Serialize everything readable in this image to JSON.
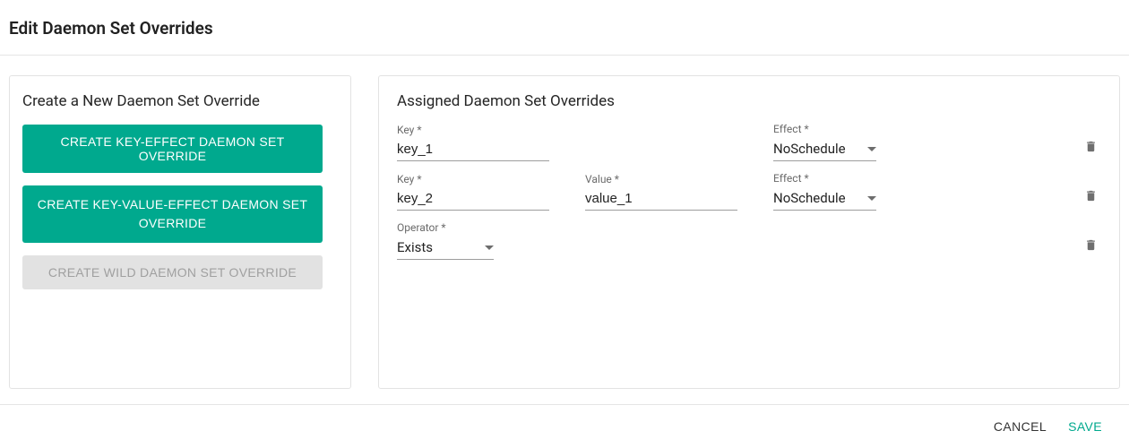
{
  "page": {
    "title": "Edit Daemon Set Overrides"
  },
  "createPanel": {
    "title": "Create a New Daemon Set Override",
    "buttons": {
      "keyEffect": "CREATE KEY-EFFECT DAEMON SET OVERRIDE",
      "keyValueEffect": "CREATE KEY-VALUE-EFFECT DAEMON SET OVERRIDE",
      "wild": "CREATE WILD DAEMON SET OVERRIDE"
    }
  },
  "assignedPanel": {
    "title": "Assigned Daemon Set Overrides",
    "labels": {
      "key": "Key *",
      "value": "Value *",
      "effect": "Effect *",
      "operator": "Operator *"
    },
    "rows": [
      {
        "type": "key-effect",
        "key": "key_1",
        "effect": "NoSchedule"
      },
      {
        "type": "key-value-effect",
        "key": "key_2",
        "value": "value_1",
        "effect": "NoSchedule"
      },
      {
        "type": "operator",
        "operator": "Exists"
      }
    ]
  },
  "footer": {
    "cancel": "CANCEL",
    "save": "SAVE"
  },
  "colors": {
    "accent": "#00a98e"
  }
}
